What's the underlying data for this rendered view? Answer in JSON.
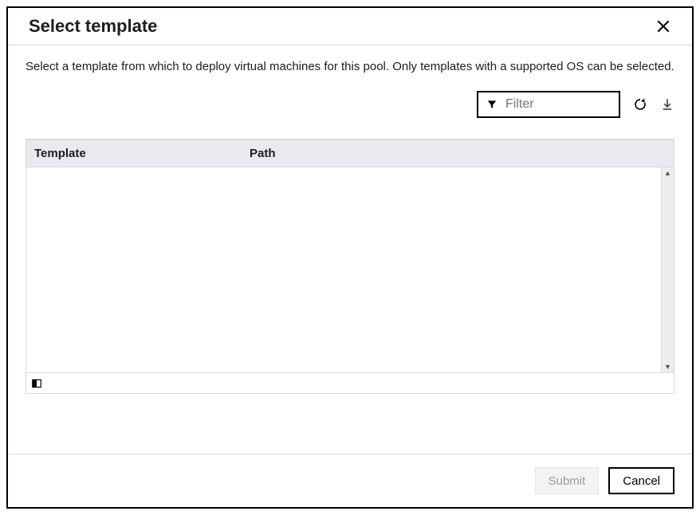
{
  "dialog": {
    "title": "Select template",
    "description": "Select a template from which to deploy virtual machines for this pool. Only templates with a supported OS can be selected."
  },
  "controls": {
    "filter_placeholder": "Filter"
  },
  "table": {
    "columns": {
      "template": "Template",
      "path": "Path"
    },
    "rows": []
  },
  "footer": {
    "submit_label": "Submit",
    "cancel_label": "Cancel"
  }
}
